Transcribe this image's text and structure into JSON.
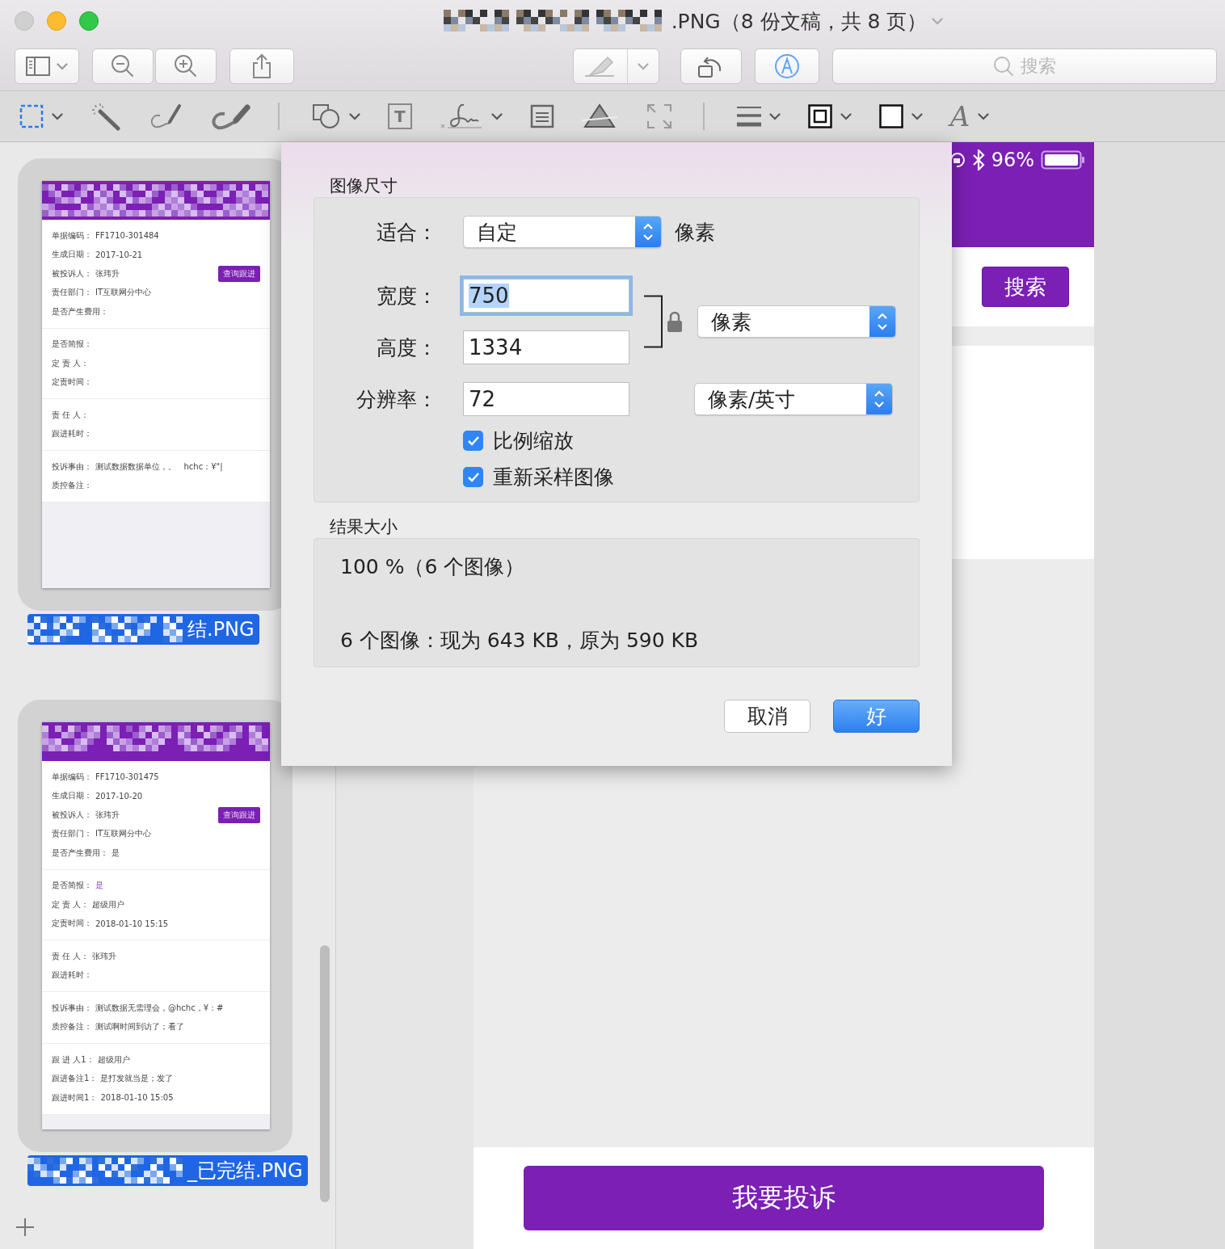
{
  "window": {
    "title": ".PNG（8 份文稿，共 8 页）"
  },
  "toolbar": {
    "search": {
      "placeholder": "搜索"
    }
  },
  "markup_toolbar": {
    "text_glyph": "T",
    "font_glyph": "A"
  },
  "sidebar": {
    "thumbnails": [
      {
        "selected": true,
        "label": "结.PNG",
        "sections": [
          [
            {
              "label": "单据编码：",
              "value": "FF1710-301484"
            },
            {
              "label": "生成日期：",
              "value": "2017-10-21"
            },
            {
              "label": "被投诉人：",
              "value": "张玮升",
              "action": "查询跟进"
            },
            {
              "label": "责任部门：",
              "value": "IT互联网分中心"
            },
            {
              "label": "是否产生费用："
            }
          ],
          [
            {
              "label": "是否简报："
            },
            {
              "label": "定 责 人："
            },
            {
              "label": "定责时间："
            }
          ],
          [
            {
              "label": "责 任 人："
            },
            {
              "label": "跟进耗时："
            }
          ],
          [
            {
              "label": "投诉事由：",
              "value": "测试数据数据单位，。   hchc：¥\"|"
            },
            {
              "label": "质控备注："
            }
          ]
        ]
      },
      {
        "selected": true,
        "label": "_已完结.PNG",
        "sections": [
          [
            {
              "label": "单据编码：",
              "value": "FF1710-301475"
            },
            {
              "label": "生成日期：",
              "value": "2017-10-20"
            },
            {
              "label": "被投诉人：",
              "value": "张玮升",
              "action": "查询跟进"
            },
            {
              "label": "责任部门：",
              "value": "IT互联网分中心"
            },
            {
              "label": "是否产生费用：",
              "value": "是"
            }
          ],
          [
            {
              "label": "是否简报：",
              "value": "是",
              "accent": true
            },
            {
              "label": "定 责 人：",
              "value": "超级用户"
            },
            {
              "label": "定责时间：",
              "value": "2018-01-10 15:15"
            }
          ],
          [
            {
              "label": "责 任 人：",
              "value": "张玮升"
            },
            {
              "label": "跟进耗时："
            }
          ],
          [
            {
              "label": "投诉事由：",
              "value": "测试数据无需理会，@hchc，¥：#"
            },
            {
              "label": "质控备注：",
              "value": "测试啊时间到访了；看了"
            }
          ],
          [
            {
              "label": "跟 进 人1：",
              "value": "超级用户"
            },
            {
              "label": "跟进备注1：",
              "value": "是打发就当是；发了"
            },
            {
              "label": "跟进时间1：",
              "value": "2018-01-10 15:05"
            }
          ]
        ]
      }
    ]
  },
  "document": {
    "battery": "96%",
    "search_button": "搜索",
    "complaint_button": "我要投诉"
  },
  "dialog": {
    "section_title": "图像尺寸",
    "fit": {
      "label": "适合：",
      "value": "自定",
      "unit": "像素"
    },
    "width": {
      "label": "宽度：",
      "value": "750",
      "focused": true
    },
    "height": {
      "label": "高度：",
      "value": "1334"
    },
    "size_unit": "像素",
    "resolution": {
      "label": "分辨率：",
      "value": "72",
      "unit": "像素/英寸"
    },
    "checkboxes": [
      {
        "label": "比例缩放",
        "checked": true
      },
      {
        "label": "重新采样图像",
        "checked": true
      }
    ],
    "result_title": "结果大小",
    "result_scale": "100 %（6 个图像）",
    "result_size": "6 个图像：现为 643 KB，原为 590 KB",
    "buttons": [
      {
        "label": "取消",
        "default": false
      },
      {
        "label": "好",
        "default": true
      }
    ]
  }
}
